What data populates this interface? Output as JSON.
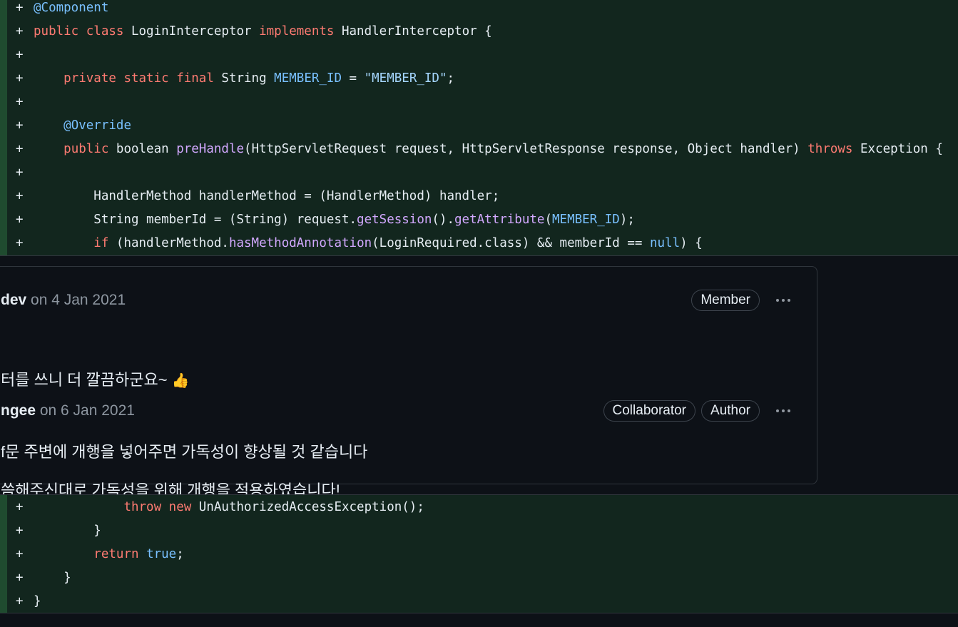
{
  "diff_top": [
    {
      "segments": [
        {
          "t": "@Component",
          "c": "ann"
        }
      ]
    },
    {
      "segments": [
        {
          "t": "public class",
          "c": "kw"
        },
        {
          "t": " LoginInterceptor ",
          "c": ""
        },
        {
          "t": "implements",
          "c": "kw"
        },
        {
          "t": " HandlerInterceptor {",
          "c": ""
        }
      ]
    },
    {
      "segments": []
    },
    {
      "segments": [
        {
          "t": "    ",
          "c": ""
        },
        {
          "t": "private static final",
          "c": "kw"
        },
        {
          "t": " String ",
          "c": ""
        },
        {
          "t": "MEMBER_ID",
          "c": "const"
        },
        {
          "t": " = ",
          "c": ""
        },
        {
          "t": "\"MEMBER_ID\"",
          "c": "str"
        },
        {
          "t": ";",
          "c": ""
        }
      ]
    },
    {
      "segments": []
    },
    {
      "segments": [
        {
          "t": "    ",
          "c": ""
        },
        {
          "t": "@Override",
          "c": "ann"
        }
      ]
    },
    {
      "segments": [
        {
          "t": "    ",
          "c": ""
        },
        {
          "t": "public",
          "c": "kw"
        },
        {
          "t": " boolean ",
          "c": ""
        },
        {
          "t": "preHandle",
          "c": "fn"
        },
        {
          "t": "(HttpServletRequest request, HttpServletResponse response, Object handler) ",
          "c": ""
        },
        {
          "t": "throws",
          "c": "kw"
        },
        {
          "t": " Exception {",
          "c": ""
        }
      ]
    },
    {
      "segments": []
    },
    {
      "segments": [
        {
          "t": "        HandlerMethod handlerMethod = (HandlerMethod) handler;",
          "c": ""
        }
      ]
    },
    {
      "segments": [
        {
          "t": "        String memberId = (String) request.",
          "c": ""
        },
        {
          "t": "getSession",
          "c": "fn"
        },
        {
          "t": "().",
          "c": ""
        },
        {
          "t": "getAttribute",
          "c": "fn"
        },
        {
          "t": "(",
          "c": ""
        },
        {
          "t": "MEMBER_ID",
          "c": "const"
        },
        {
          "t": ");",
          "c": ""
        }
      ]
    },
    {
      "segments": [
        {
          "t": "        ",
          "c": ""
        },
        {
          "t": "if",
          "c": "kw"
        },
        {
          "t": " (handlerMethod.",
          "c": ""
        },
        {
          "t": "hasMethodAnnotation",
          "c": "fn"
        },
        {
          "t": "(LoginRequired.class) && memberId == ",
          "c": ""
        },
        {
          "t": "null",
          "c": "const"
        },
        {
          "t": ") {",
          "c": ""
        }
      ]
    }
  ],
  "diff_bottom": [
    {
      "segments": [
        {
          "t": "            ",
          "c": ""
        },
        {
          "t": "throw new",
          "c": "kw"
        },
        {
          "t": " UnAuthorizedAccessException();",
          "c": ""
        }
      ]
    },
    {
      "segments": [
        {
          "t": "        }",
          "c": ""
        }
      ]
    },
    {
      "segments": [
        {
          "t": "        ",
          "c": ""
        },
        {
          "t": "return",
          "c": "kw"
        },
        {
          "t": " ",
          "c": ""
        },
        {
          "t": "true",
          "c": "const"
        },
        {
          "t": ";",
          "c": ""
        }
      ]
    },
    {
      "segments": [
        {
          "t": "    }",
          "c": ""
        }
      ]
    },
    {
      "segments": [
        {
          "t": "}",
          "c": ""
        }
      ]
    }
  ],
  "diff_marker": "+",
  "comments": [
    {
      "author": "dev",
      "date": " on 4 Jan 2021",
      "badges": [
        "Member"
      ],
      "body_lines": [
        "터를 쓰니 더 깔끔하군요~ ",
        "f문 주변에 개행을 넣어주면 가독성이 향상될 것 같습니다"
      ],
      "emoji": "👍"
    },
    {
      "author": "ngee",
      "date": " on 6 Jan 2021",
      "badges": [
        "Collaborator",
        "Author"
      ],
      "body_lines": [
        "씀해주신대로 가독성을 위해 개행을 적용하였습니다!"
      ],
      "emoji": ""
    }
  ]
}
